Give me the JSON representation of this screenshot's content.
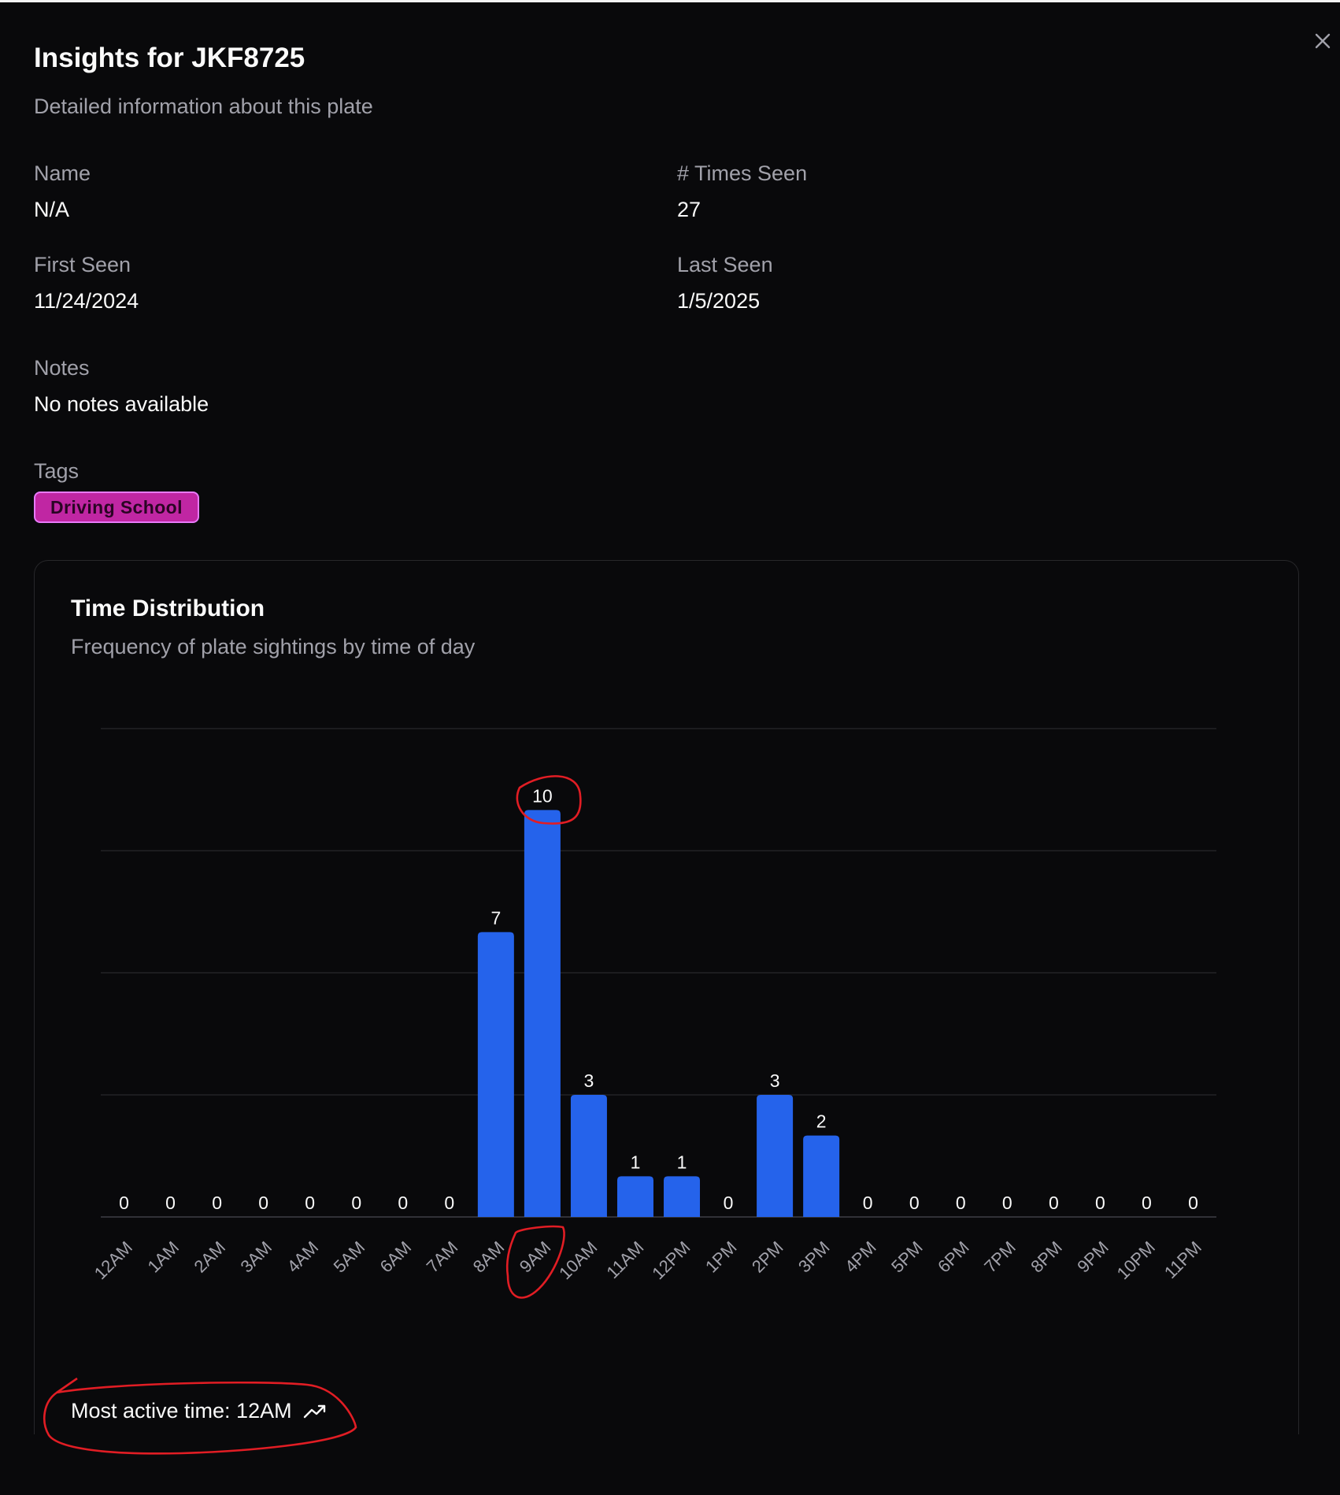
{
  "dialog": {
    "title": "Insights for JKF8725",
    "subtitle": "Detailed information about this plate",
    "close_icon": "close-icon"
  },
  "fields": {
    "name_label": "Name",
    "name_value": "N/A",
    "times_seen_label": "# Times Seen",
    "times_seen_value": "27",
    "first_seen_label": "First Seen",
    "first_seen_value": "11/24/2024",
    "last_seen_label": "Last Seen",
    "last_seen_value": "1/5/2025",
    "notes_label": "Notes",
    "notes_value": "No notes available",
    "tags_label": "Tags"
  },
  "tags": [
    {
      "label": "Driving School",
      "color": "#c026a3"
    }
  ],
  "card": {
    "title": "Time Distribution",
    "subtitle": "Frequency of plate sightings by time of day",
    "footer_text": "Most active time: 12AM",
    "footer_icon": "trending-up-icon"
  },
  "colors": {
    "background": "#09090b",
    "bar": "#2563eb",
    "muted_text": "#a1a1aa",
    "annotation": "#e11d24"
  },
  "chart_data": {
    "type": "bar",
    "categories": [
      "12AM",
      "1AM",
      "2AM",
      "3AM",
      "4AM",
      "5AM",
      "6AM",
      "7AM",
      "8AM",
      "9AM",
      "10AM",
      "11AM",
      "12PM",
      "1PM",
      "2PM",
      "3PM",
      "4PM",
      "5PM",
      "6PM",
      "7PM",
      "8PM",
      "9PM",
      "10PM",
      "11PM"
    ],
    "values": [
      0,
      0,
      0,
      0,
      0,
      0,
      0,
      0,
      7,
      10,
      3,
      1,
      1,
      0,
      3,
      2,
      0,
      0,
      0,
      0,
      0,
      0,
      0,
      0
    ],
    "ylim": [
      0,
      12
    ],
    "grid": true,
    "data_labels": true
  }
}
